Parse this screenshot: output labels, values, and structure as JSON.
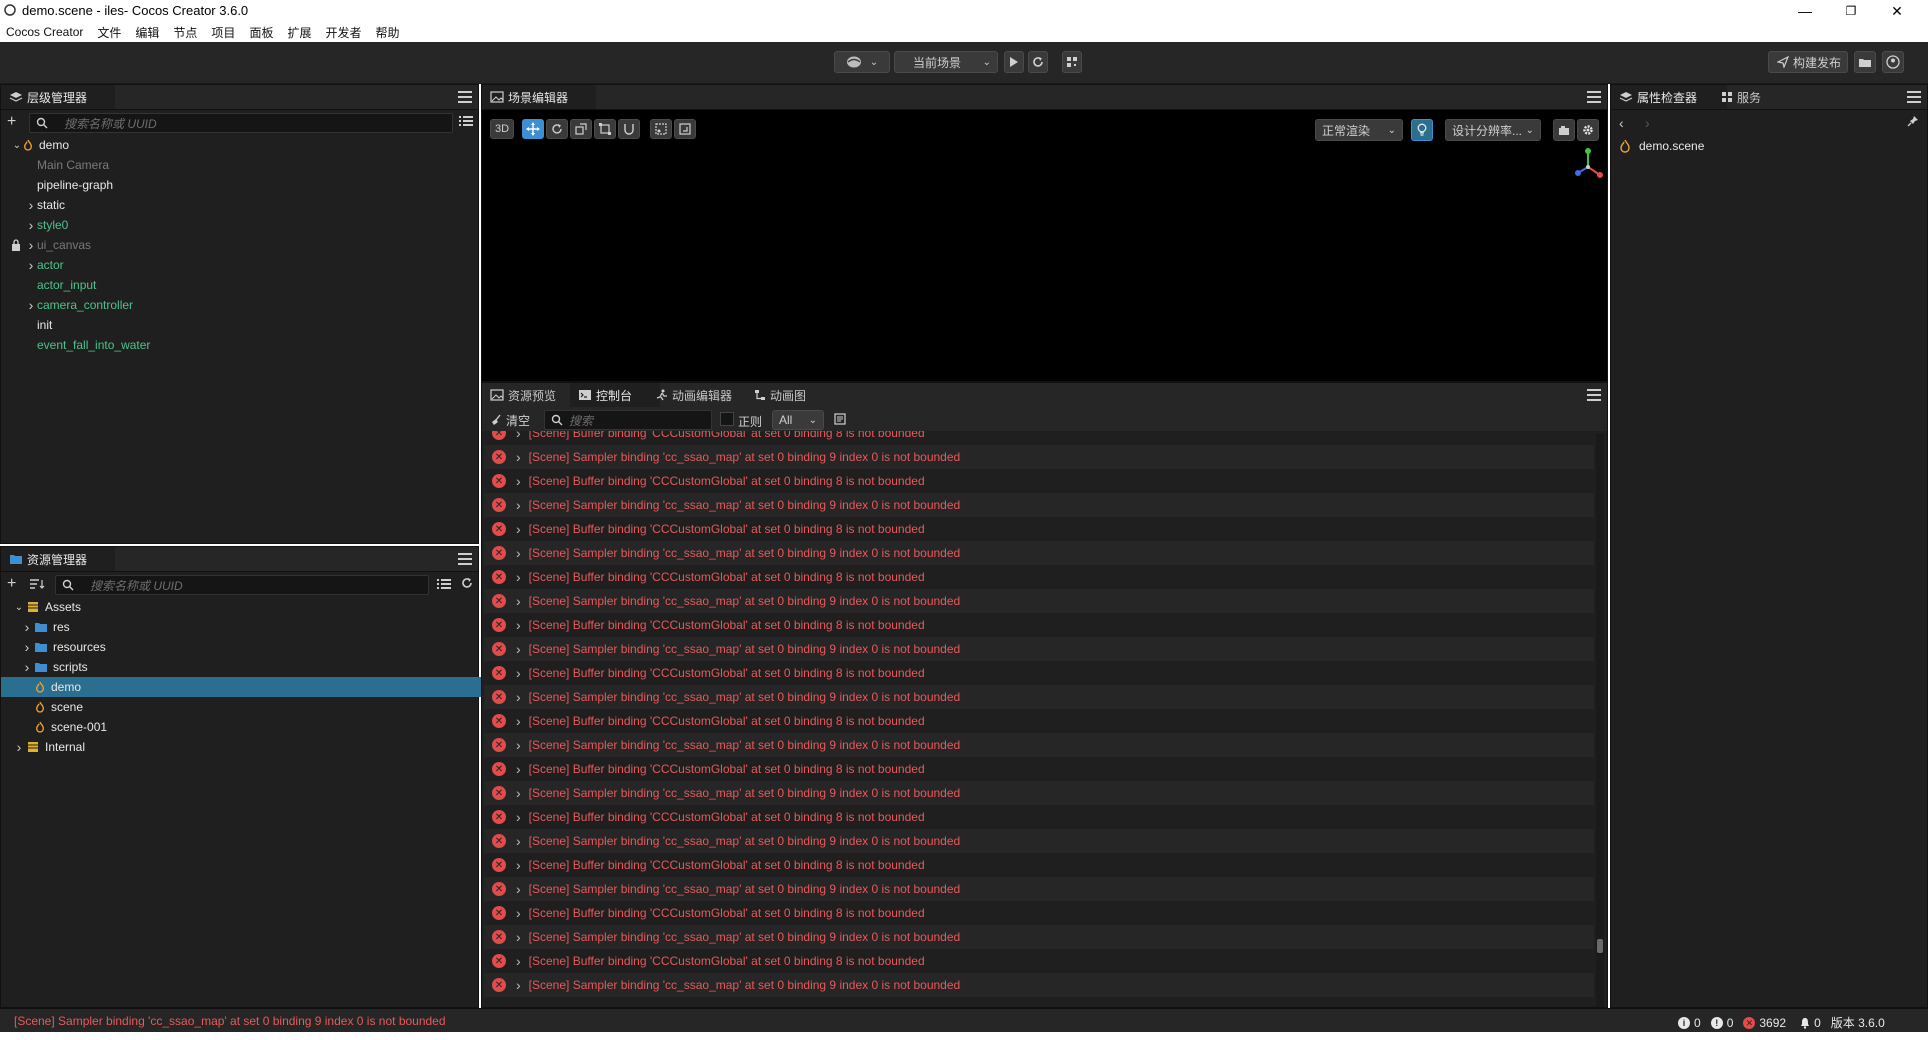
{
  "window": {
    "title": "demo.scene - iles- Cocos Creator 3.6.0",
    "minimize": "—",
    "maximize": "❐",
    "close": "✕"
  },
  "menu": [
    "Cocos Creator",
    "文件",
    "编辑",
    "节点",
    "项目",
    "面板",
    "扩展",
    "开发者",
    "帮助"
  ],
  "toolbar": {
    "scene_select": "当前场景",
    "build_publish": "构建发布"
  },
  "hierarchy": {
    "tab": "层级管理器",
    "search_placeholder": "搜索名称或 UUID",
    "nodes": [
      {
        "label": "demo",
        "indent": 0,
        "arrow": "down",
        "style": "white",
        "icon": true
      },
      {
        "label": "Main Camera",
        "indent": 1,
        "arrow": "",
        "style": "gray"
      },
      {
        "label": "pipeline-graph",
        "indent": 1,
        "arrow": "",
        "style": "white"
      },
      {
        "label": "static",
        "indent": 1,
        "arrow": "right",
        "style": "white"
      },
      {
        "label": "style0",
        "indent": 1,
        "arrow": "right",
        "style": "green"
      },
      {
        "label": "ui_canvas",
        "indent": 1,
        "arrow": "right",
        "style": "gray",
        "lock": true
      },
      {
        "label": "actor",
        "indent": 1,
        "arrow": "right",
        "style": "green"
      },
      {
        "label": "actor_input",
        "indent": 1,
        "arrow": "",
        "style": "green"
      },
      {
        "label": "camera_controller",
        "indent": 1,
        "arrow": "right",
        "style": "green"
      },
      {
        "label": "init",
        "indent": 1,
        "arrow": "",
        "style": "white"
      },
      {
        "label": "event_fall_into_water",
        "indent": 1,
        "arrow": "",
        "style": "green"
      }
    ]
  },
  "assets": {
    "tab": "资源管理器",
    "search_placeholder": "搜索名称或 UUID",
    "items": [
      {
        "label": "Assets",
        "indent": 0,
        "arrow": "down",
        "type": "db"
      },
      {
        "label": "res",
        "indent": 1,
        "arrow": "right",
        "type": "folder"
      },
      {
        "label": "resources",
        "indent": 1,
        "arrow": "right",
        "type": "folder"
      },
      {
        "label": "scripts",
        "indent": 1,
        "arrow": "right",
        "type": "folder"
      },
      {
        "label": "demo",
        "indent": 1,
        "arrow": "",
        "type": "scene",
        "selected": true
      },
      {
        "label": "scene",
        "indent": 1,
        "arrow": "",
        "type": "scene"
      },
      {
        "label": "scene-001",
        "indent": 1,
        "arrow": "",
        "type": "scene"
      },
      {
        "label": "Internal",
        "indent": 0,
        "arrow": "right",
        "type": "db"
      }
    ]
  },
  "scene_editor": {
    "tab": "场景编辑器",
    "mode_3d": "3D",
    "render_mode": "正常渲染",
    "resolution": "设计分辨率..."
  },
  "bottom_tabs": [
    "资源预览",
    "控制台",
    "动画编辑器",
    "动画图"
  ],
  "console": {
    "clear_label": "清空",
    "search_placeholder": "搜索",
    "regex_label": "正则",
    "filter_value": "All",
    "message_a": "[Scene] Buffer binding 'CCCustomGlobal' at set 0 binding 8 is not bounded",
    "message_b": "[Scene] Sampler binding 'cc_ssao_map' at set 0 binding 9 index 0 is not bounded"
  },
  "inspector": {
    "tab": "属性检查器",
    "tab2": "服务",
    "file": "demo.scene"
  },
  "status": {
    "message": "[Scene] Sampler binding 'cc_ssao_map' at set 0 binding 9 index 0 is not bounded",
    "info_count": "0",
    "warn_count": "0",
    "error_count": "3692",
    "notif_count": "0",
    "version": "版本 3.6.0"
  },
  "colors": {
    "selection": "#2a6f8f",
    "error": "#e55a5a",
    "green_node": "#4fc28a",
    "accent": "#3d8fd1"
  }
}
